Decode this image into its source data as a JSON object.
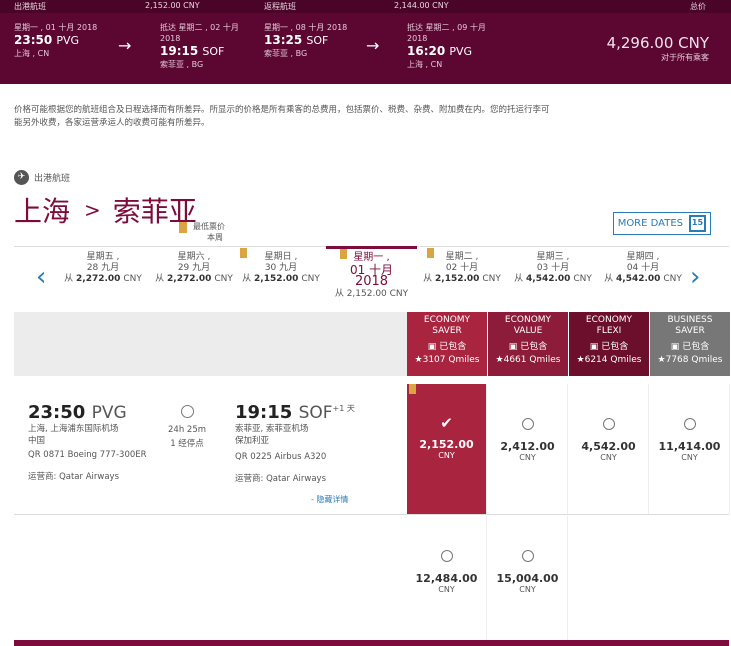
{
  "top": {
    "outbound_label": "出港航班",
    "outbound_price": "2,152.00 CNY",
    "return_label": "返程航班",
    "return_price": "2,144.00 CNY",
    "total_label": "总价",
    "legs": [
      {
        "date": "星期一 , 01 十月 2018",
        "time": "23:50",
        "code": "PVG",
        "city": "上海 , CN"
      },
      {
        "date": "抵达 星期二 , 02 十月 2018",
        "time": "19:15",
        "code": "SOF",
        "city": "索菲亚 , BG"
      },
      {
        "date": "星期一 , 08 十月 2018",
        "time": "13:25",
        "code": "SOF",
        "city": "索菲亚 , BG"
      },
      {
        "date": "抵达 星期二 , 09 十月 2018",
        "time": "16:20",
        "code": "PVG",
        "city": "上海 , CN"
      }
    ],
    "total_amount": "4,296.00 CNY",
    "total_note": "对于所有乘客"
  },
  "disclaimer": "价格可能根据您的航班组合及日程选择而有所差异。所显示的价格是所有乘客的总费用，包括票价、税费、杂费、附加费在内。您的托运行李可能另外收费，各家运营承运人的收费可能有所差异。",
  "outbound": {
    "label": "出港航班",
    "from": "上海",
    "to": "索菲亚",
    "lowest_label": "最低票价",
    "lowest_sub": "本周",
    "more_dates": "MORE DATES",
    "cal_num": "15"
  },
  "dates": [
    {
      "day": "星期五 ,",
      "dm": "28 九月",
      "from": "从",
      "price": "2,272.00",
      "cur": "CNY",
      "flag": false
    },
    {
      "day": "星期六 ,",
      "dm": "29 九月",
      "from": "从",
      "price": "2,272.00",
      "cur": "CNY",
      "flag": false
    },
    {
      "day": "星期日 ,",
      "dm": "30 九月",
      "from": "从",
      "price": "2,152.00",
      "cur": "CNY",
      "flag": true
    },
    {
      "day": "星期二 ,",
      "dm": "02 十月",
      "from": "从",
      "price": "2,152.00",
      "cur": "CNY",
      "flag": true
    },
    {
      "day": "星期三 ,",
      "dm": "03 十月",
      "from": "从",
      "price": "4,542.00",
      "cur": "CNY",
      "flag": false
    },
    {
      "day": "星期四 ,",
      "dm": "04 十月",
      "from": "从",
      "price": "4,542.00",
      "cur": "CNY",
      "flag": false
    }
  ],
  "selected_date": {
    "day": "星期一 ,",
    "dm": "01 十月",
    "yr": "2018",
    "price_text": "从 2,152.00 CNY"
  },
  "fares": [
    {
      "line1": "ECONOMY",
      "line2": "SAVER",
      "included": "已包含",
      "qmiles": "3107 Qmiles",
      "color": "#a8243f"
    },
    {
      "line1": "ECONOMY",
      "line2": "VALUE",
      "included": "已包含",
      "qmiles": "4661 Qmiles",
      "color": "#8c1c3a"
    },
    {
      "line1": "ECONOMY",
      "line2": "FLEXI",
      "included": "已包含",
      "qmiles": "6214 Qmiles",
      "color": "#6b0f2c"
    },
    {
      "line1": "BUSINESS",
      "line2": "SAVER",
      "included": "已包含",
      "qmiles": "7768 Qmiles",
      "color": "#777777"
    }
  ],
  "flight": {
    "dep_time": "23:50",
    "dep_code": "PVG",
    "dep_airport": "上海, 上海浦东国际机场",
    "dep_country": "中国",
    "flight1": "QR 0871 Boeing 777-300ER",
    "operator1": "运营商: Qatar Airways",
    "duration": "24h 25m",
    "stops": "1 经停点",
    "arr_time": "19:15",
    "arr_code": "SOF",
    "arr_plus": "+1 天",
    "arr_airport": "索菲亚, 索菲亚机场",
    "arr_country": "保加利亚",
    "flight2": "QR 0225 Airbus A320",
    "operator2": "运营商: Qatar Airways",
    "hide_details": "- 隐藏详情"
  },
  "prices_row1": [
    {
      "amt": "2,152.00",
      "cur": "CNY",
      "selected": true
    },
    {
      "amt": "2,412.00",
      "cur": "CNY",
      "selected": false
    },
    {
      "amt": "4,542.00",
      "cur": "CNY",
      "selected": false
    },
    {
      "amt": "11,414.00",
      "cur": "CNY",
      "selected": false
    }
  ],
  "prices_row2": [
    {
      "amt": "12,484.00",
      "cur": "CNY"
    },
    {
      "amt": "15,004.00",
      "cur": "CNY"
    }
  ]
}
